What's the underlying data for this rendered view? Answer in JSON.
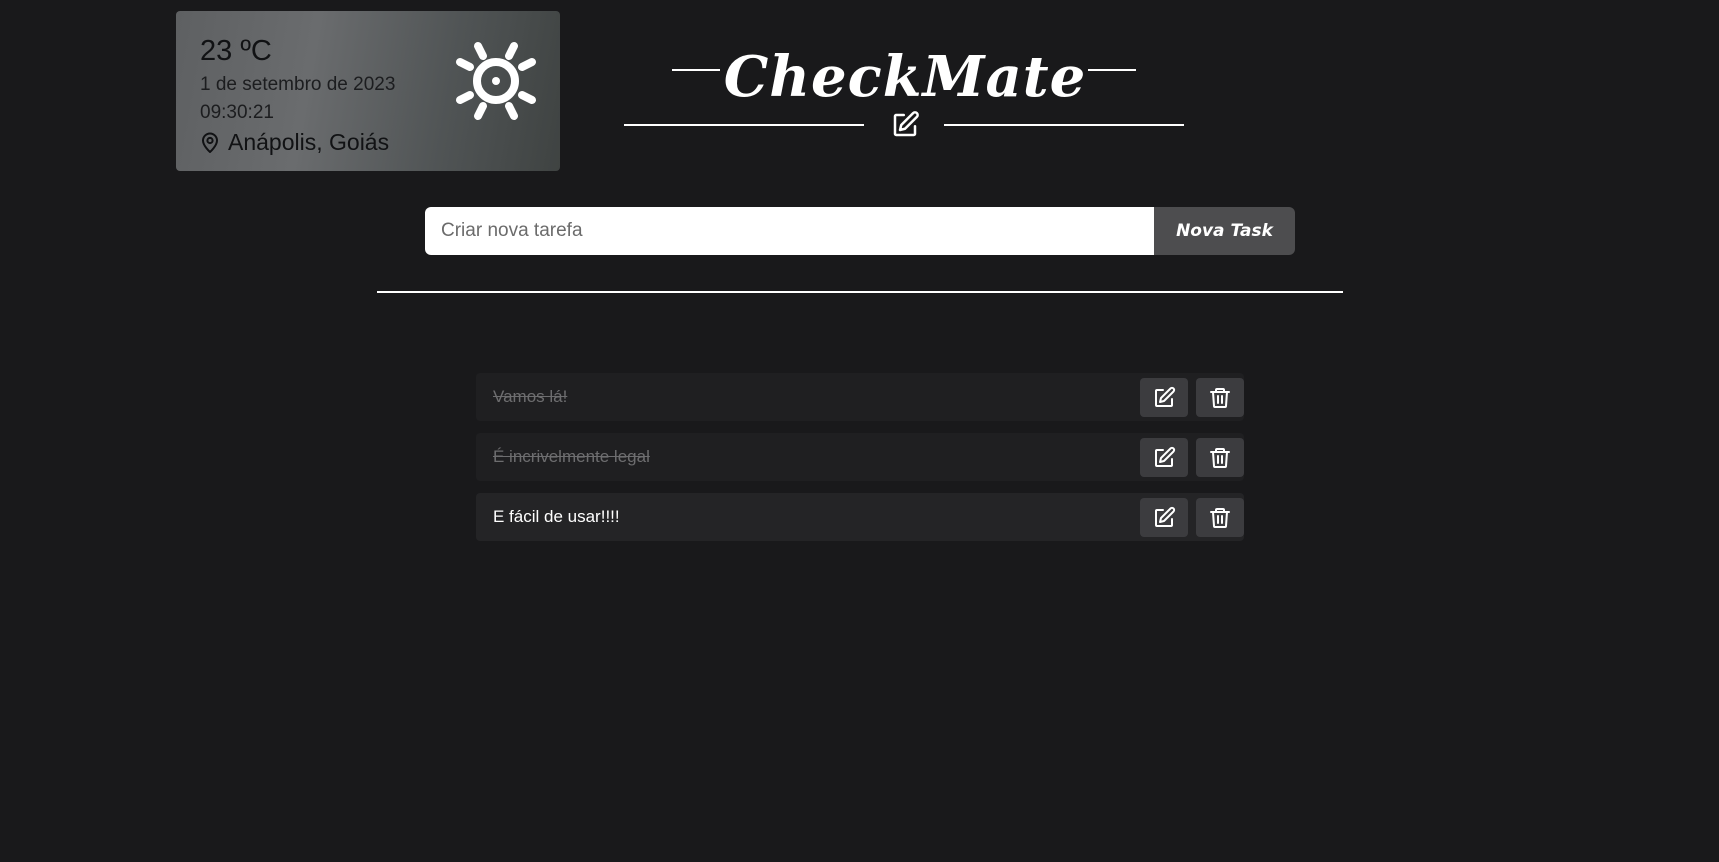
{
  "weather": {
    "temperature": "23 ºC",
    "date": "1 de setembro de 2023",
    "time": "09:30:21",
    "location": "Anápolis, Goiás",
    "condition_icon": "sun-icon"
  },
  "header": {
    "title": "CheckMate",
    "icon": "edit-icon"
  },
  "new_task": {
    "placeholder": "Criar nova tarefa",
    "value": "",
    "button_label": "Nova Task"
  },
  "tasks": [
    {
      "text": "Vamos lá!",
      "done": true
    },
    {
      "text": "É incrivelmente legal",
      "done": true
    },
    {
      "text": "E fácil de usar!!!!",
      "done": false
    }
  ],
  "colors": {
    "background": "#19191b",
    "button": "#4d4d4f",
    "task_row": "#1f1f21",
    "action_button": "#3c3c3f",
    "done_text": "#6d6d6f"
  }
}
